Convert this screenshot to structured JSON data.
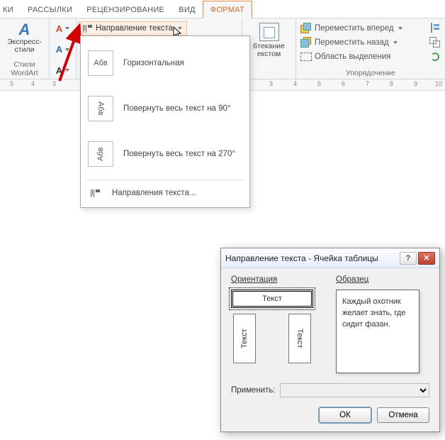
{
  "tabs": {
    "partial": "КИ",
    "mailings": "РАССЫЛКИ",
    "review": "РЕЦЕНЗИРОВАНИЕ",
    "view": "ВИД",
    "format": "ФОРМАТ"
  },
  "ribbon": {
    "wordart_styles": {
      "big": "Экспресс-\nстили",
      "group": "Стили WordArt"
    },
    "text_direction_btn": "Направление текста",
    "position_big": "",
    "wrap_big": "бтекание\nекстом",
    "arrange_group": "Упорядочение",
    "bring_forward": "Переместить вперед",
    "send_backward": "Переместить назад",
    "selection_pane": "Область выделения"
  },
  "menu": {
    "abv": "Абв",
    "horizontal": "Горизонтальная",
    "rotate90": "Повернуть весь текст на 90°",
    "rotate270": "Повернуть весь текст на 270°",
    "more": "Направления текста..."
  },
  "ruler": {
    "l5": "5",
    "l4": "4",
    "l3": "3",
    "r3": "3",
    "r4": "4",
    "r5": "5",
    "r6": "6",
    "r7": "7",
    "r8": "8",
    "r9": "9",
    "r10": "10"
  },
  "dialog": {
    "title": "Направление текста - Ячейка таблицы",
    "orientation_h": "Ориентация",
    "sample_h": "Образец",
    "opt_text": "Текст",
    "sample_text": "Каждый охотник желает знать, где сидит фазан.",
    "apply_label": "Применить:",
    "ok": "ОК",
    "cancel": "Отмена"
  }
}
